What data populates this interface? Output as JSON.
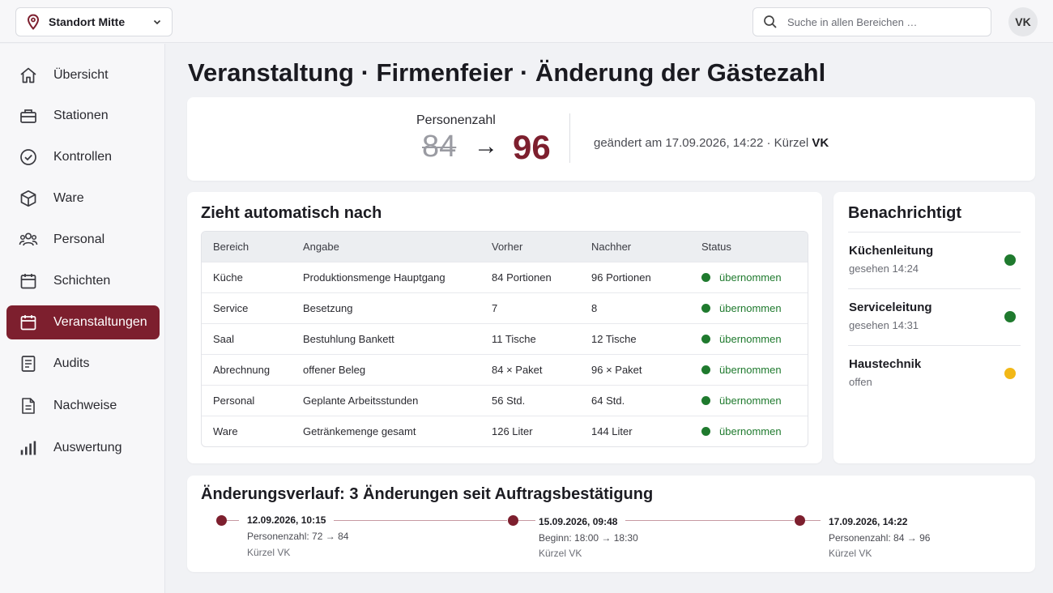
{
  "topbar": {
    "location_label": "Standort Mitte",
    "search_placeholder": "Suche in allen Bereichen …",
    "user_initials": "VK"
  },
  "sidebar": {
    "items": [
      {
        "label": "Übersicht",
        "icon": "home-icon"
      },
      {
        "label": "Stationen",
        "icon": "station-icon"
      },
      {
        "label": "Kontrollen",
        "icon": "check-circle-icon"
      },
      {
        "label": "Ware",
        "icon": "box-icon"
      },
      {
        "label": "Personal",
        "icon": "people-icon"
      },
      {
        "label": "Schichten",
        "icon": "calendar-icon"
      },
      {
        "label": "Veranstaltungen",
        "icon": "calendar-event-icon",
        "active": true
      },
      {
        "label": "Audits",
        "icon": "clipboard-icon"
      },
      {
        "label": "Nachweise",
        "icon": "document-icon"
      },
      {
        "label": "Auswertung",
        "icon": "bar-chart-icon"
      }
    ]
  },
  "main": {
    "title": "Veranstaltung · Firmenfeier · Änderung der Gästezahl",
    "summary": {
      "label": "Personenzahl",
      "old_value": "84",
      "arrow": "→",
      "new_value": "96",
      "changed_text": "geändert am 17.09.2026, 14:22 · Kürzel ",
      "changed_by": "VK"
    },
    "propagation": {
      "title": "Zieht automatisch nach",
      "columns": [
        "Bereich",
        "Angabe",
        "Vorher",
        "Nachher",
        "Status"
      ],
      "rows": [
        [
          "Küche",
          "Produktionsmenge Hauptgang",
          "84 Portionen",
          "96 Portionen",
          "übernommen"
        ],
        [
          "Service",
          "Besetzung",
          "7",
          "8",
          "übernommen"
        ],
        [
          "Saal",
          "Bestuhlung Bankett",
          "11 Tische",
          "12 Tische",
          "übernommen"
        ],
        [
          "Abrechnung",
          "offener Beleg",
          "84 × Paket",
          "96 × Paket",
          "übernommen"
        ],
        [
          "Personal",
          "Geplante Arbeitsstunden",
          "56 Std.",
          "64 Std.",
          "übernommen"
        ],
        [
          "Ware",
          "Getränkemenge gesamt",
          "126 Liter",
          "144 Liter",
          "übernommen"
        ]
      ],
      "status_color": "#1f7a2e"
    },
    "notified": {
      "title": "Benachrichtigt",
      "items": [
        {
          "name": "Küchenleitung",
          "status": "gesehen 14:24",
          "color": "#1f7a2e"
        },
        {
          "name": "Serviceleitung",
          "status": "gesehen 14:31",
          "color": "#1f7a2e"
        },
        {
          "name": "Haustechnik",
          "status": "offen",
          "color": "#f2b817"
        }
      ]
    },
    "history": {
      "title": "Änderungsverlauf: 3 Änderungen seit Auftragsbestätigung",
      "events": [
        {
          "date": "12.09.2026, 10:15",
          "change": "Personenzahl: 72 → 84",
          "by": "Kürzel VK"
        },
        {
          "date": "15.09.2026, 09:48",
          "change": "Beginn: 18:00 → 18:30",
          "by": "Kürzel VK"
        },
        {
          "date": "17.09.2026,  14:22",
          "change": "Personenzahl: 84 → 96",
          "by": "Kürzel VK"
        }
      ]
    }
  },
  "colors": {
    "accent": "#7d1f2e",
    "ok": "#1f7a2e",
    "pending": "#f2b817"
  }
}
